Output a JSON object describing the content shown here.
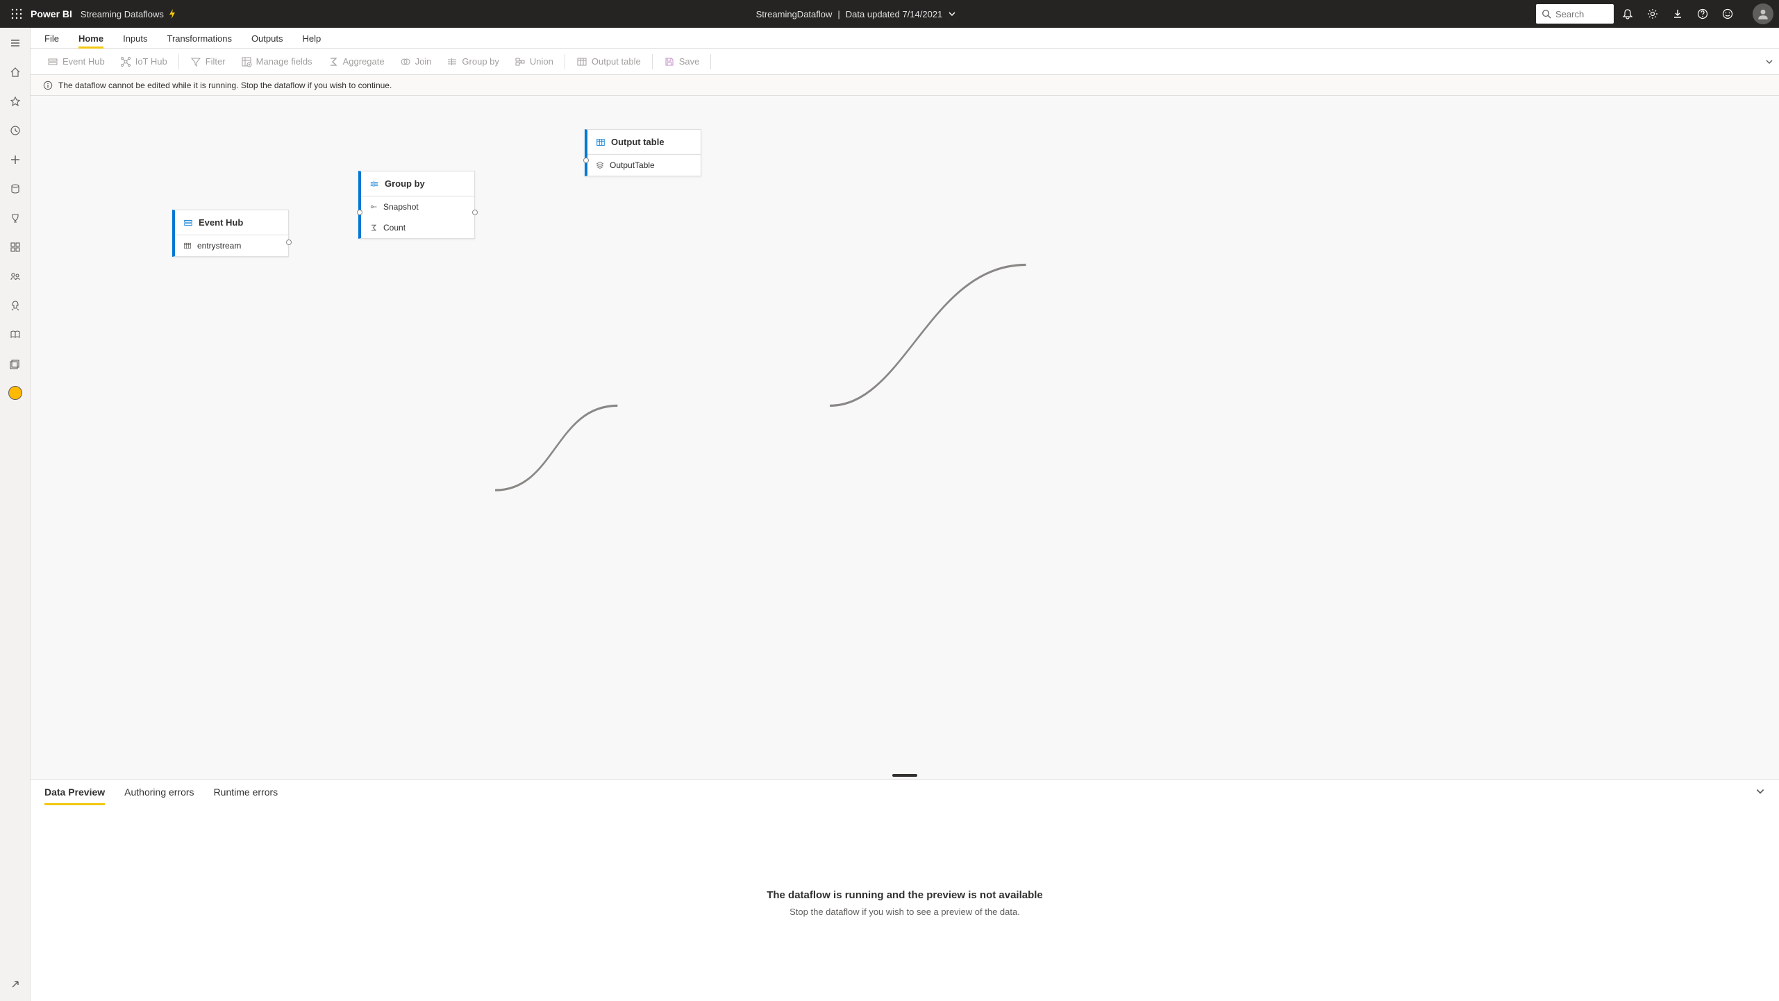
{
  "header": {
    "brand": "Power BI",
    "subtitle": "Streaming Dataflows",
    "center_title": "StreamingDataflow",
    "center_updated": "Data updated 7/14/2021",
    "search_placeholder": "Search"
  },
  "menutabs": {
    "file": "File",
    "home": "Home",
    "inputs": "Inputs",
    "transformations": "Transformations",
    "outputs": "Outputs",
    "help": "Help"
  },
  "ribbon": {
    "event_hub": "Event Hub",
    "iot_hub": "IoT Hub",
    "filter": "Filter",
    "manage_fields": "Manage fields",
    "aggregate": "Aggregate",
    "join": "Join",
    "group_by": "Group by",
    "union": "Union",
    "output_table": "Output table",
    "save": "Save"
  },
  "banner": {
    "message": "The dataflow cannot be edited while it is running. Stop the dataflow if you wish to continue."
  },
  "nodes": {
    "event_hub": {
      "title": "Event Hub",
      "row1": "entrystream"
    },
    "group_by": {
      "title": "Group by",
      "row1": "Snapshot",
      "row2": "Count"
    },
    "output_table": {
      "title": "Output table",
      "row1": "OutputTable"
    }
  },
  "bottom_tabs": {
    "data_preview": "Data Preview",
    "authoring_errors": "Authoring errors",
    "runtime_errors": "Runtime errors"
  },
  "bottom_content": {
    "title": "The dataflow is running and the preview is not available",
    "sub": "Stop the dataflow if you wish to see a preview of the data."
  }
}
